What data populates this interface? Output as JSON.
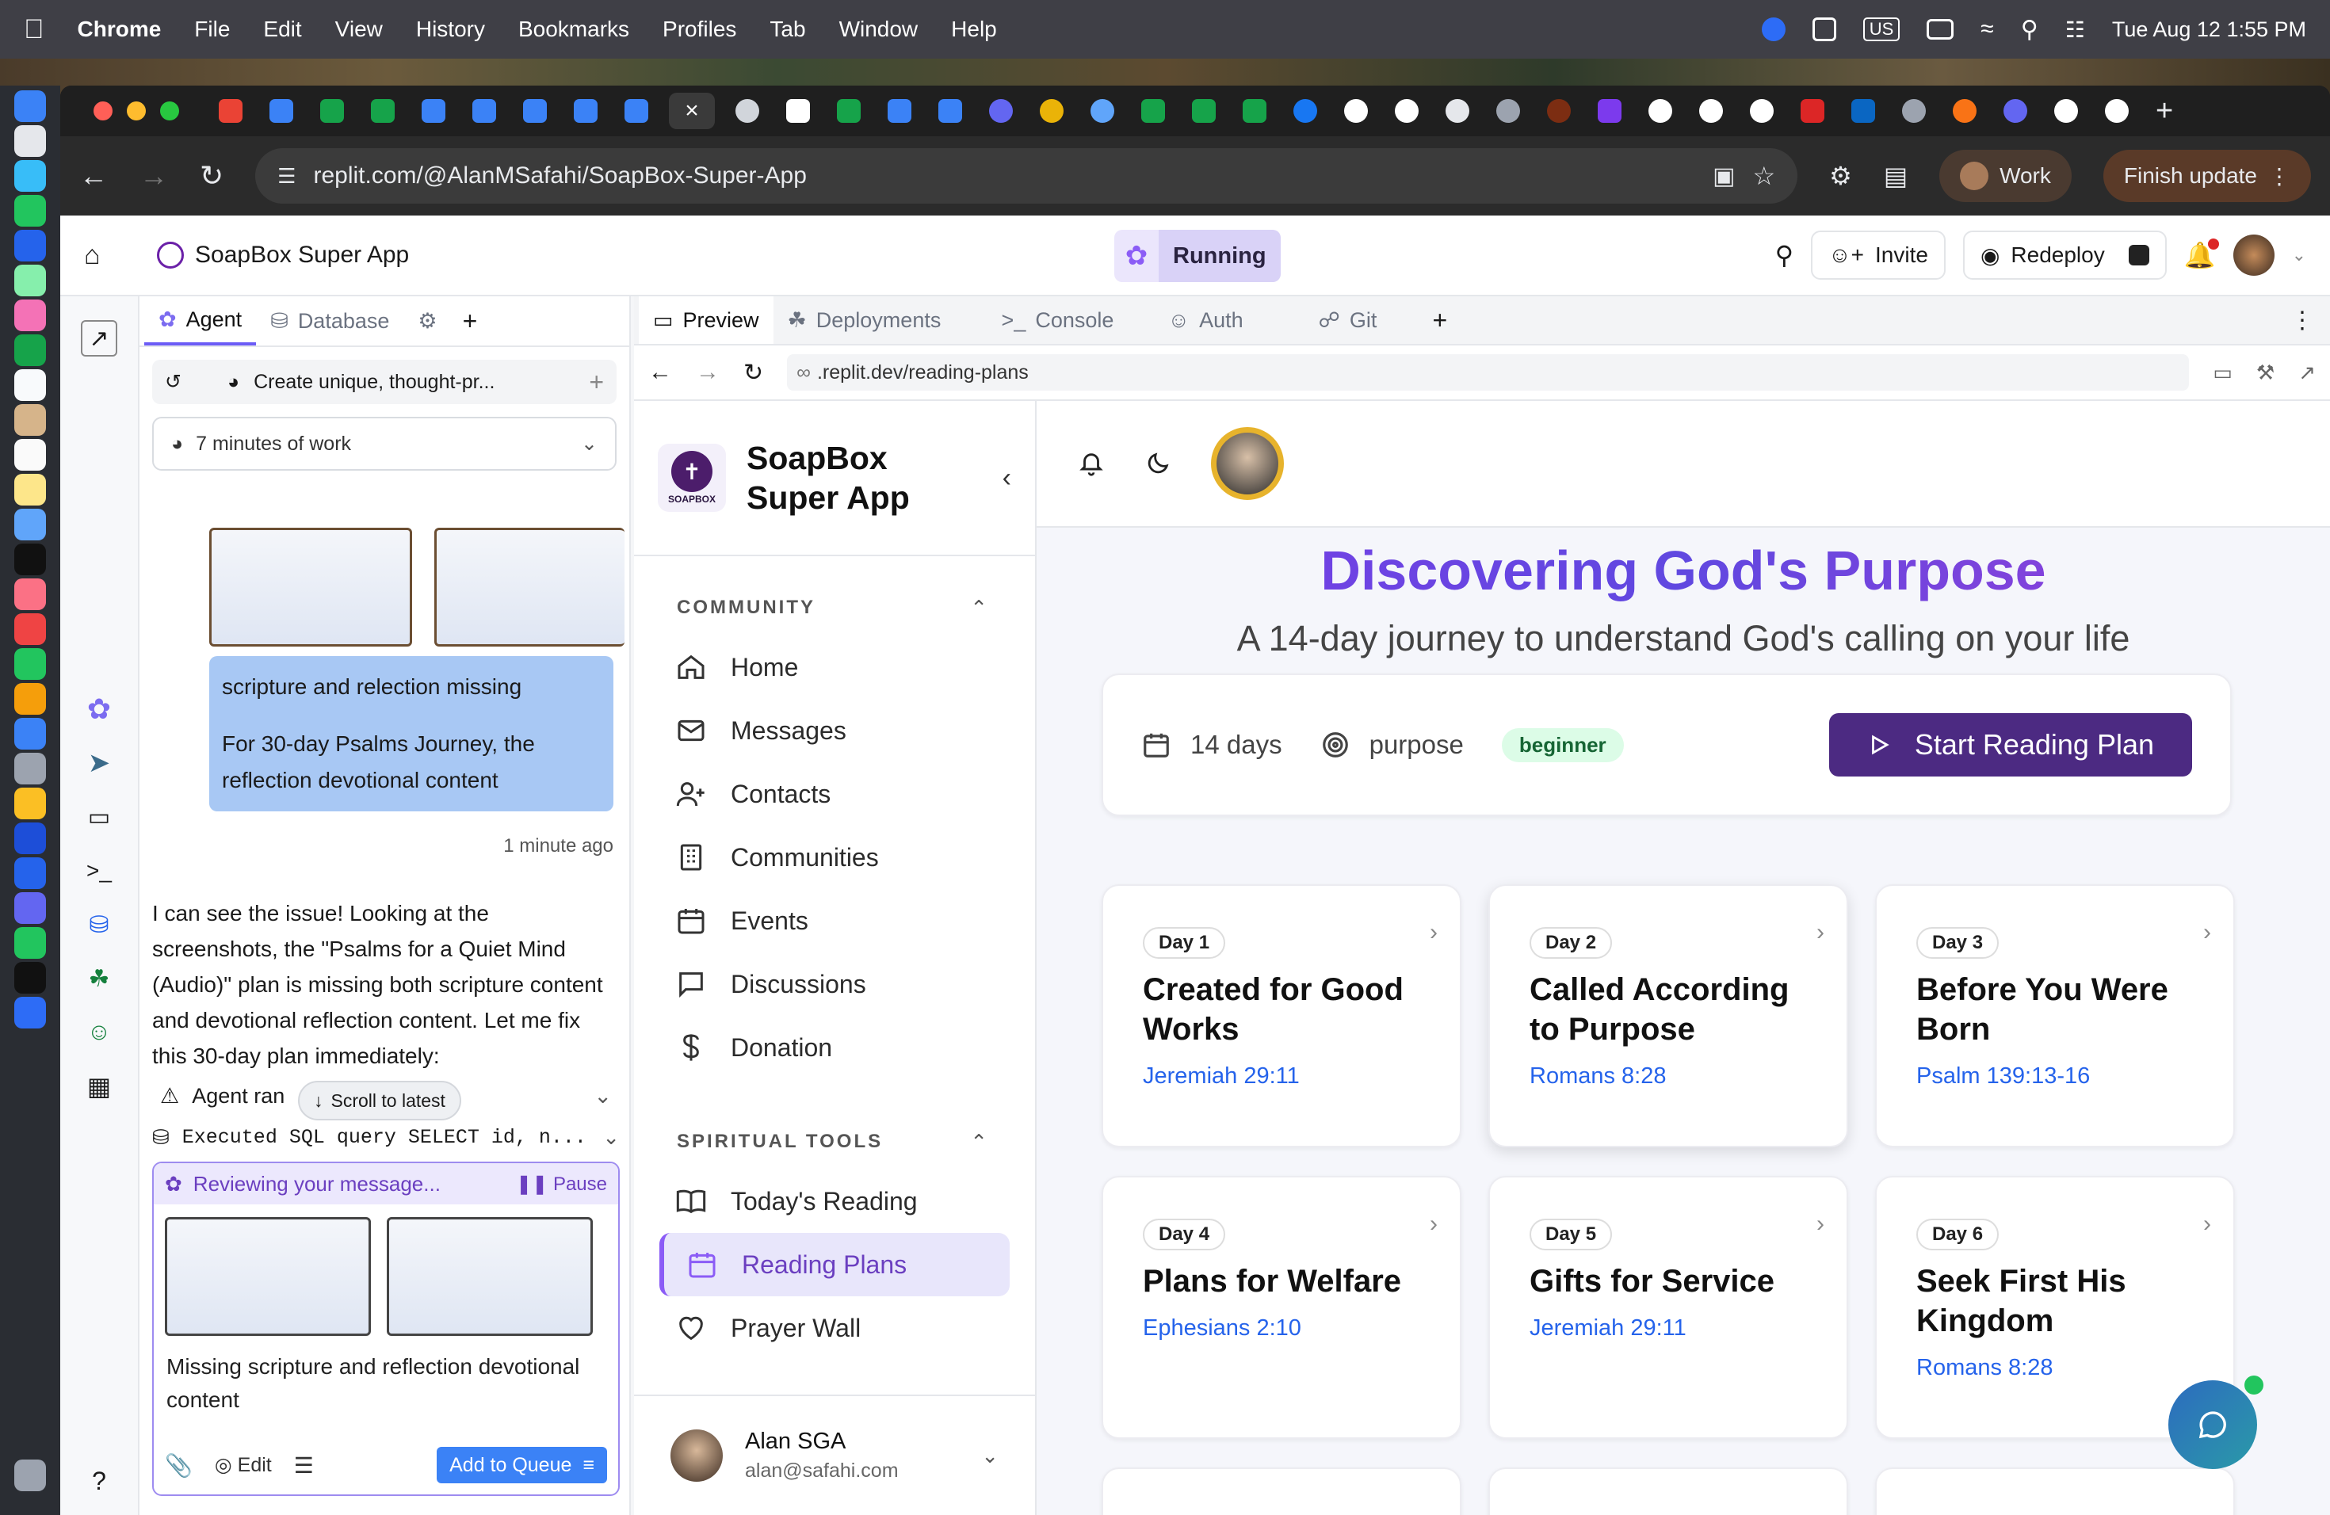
{
  "menubar": {
    "app": "Chrome",
    "items": [
      "File",
      "Edit",
      "View",
      "History",
      "Bookmarks",
      "Profiles",
      "Tab",
      "Window",
      "Help"
    ],
    "input_source": "US",
    "clock": "Tue Aug 12  1:55 PM"
  },
  "chrome": {
    "url": "replit.com/@AlanMSafahi/SoapBox-Super-App",
    "profile_label": "Work",
    "update_label": "Finish update"
  },
  "replit": {
    "project_name": "SoapBox Super App",
    "status": "Running",
    "invite_label": "Invite",
    "redeploy_label": "Redeploy",
    "left_tabs": [
      "Agent",
      "Database"
    ],
    "right_tabs": [
      "Preview",
      "Deployments",
      "Console",
      "Auth",
      "Git"
    ],
    "preview_url": ".replit.dev/reading-plans"
  },
  "agent": {
    "thread_title": "Create unique, thought-pr...",
    "work_time": "7 minutes of work",
    "user_msg_line1": "scripture and relection missing",
    "user_msg_line2": "For 30-day Psalms Journey, the reflection devotional content",
    "user_msg_time": "1 minute ago",
    "reply": "I can see the issue! Looking at the screenshots, the \"Psalms for a Quiet Mind (Audio)\" plan is missing both scripture content and devotional reflection content. Let me fix this 30-day plan immediately:",
    "agent_ran": "Agent ran",
    "scroll_latest": "Scroll to latest",
    "sql_step": "Executed SQL query SELECT id, n...",
    "reviewing": "Reviewing your message...",
    "pause_label": "Pause",
    "draft": "Missing scripture and reflection devotional content",
    "edit_label": "Edit",
    "queue_label": "Add to Queue"
  },
  "app": {
    "brand_line1": "SoapBox",
    "brand_line2": "Super App",
    "logo_text": "SOAPBOX",
    "community_header": "COMMUNITY",
    "community_items": [
      "Home",
      "Messages",
      "Contacts",
      "Communities",
      "Events",
      "Discussions",
      "Donation"
    ],
    "tools_header": "SPIRITUAL TOOLS",
    "tools_items": [
      "Today's Reading",
      "Reading Plans",
      "Prayer Wall"
    ],
    "user_name": "Alan SGA",
    "user_email": "alan@safahi.com",
    "plan_title": "Discovering God's Purpose",
    "plan_subtitle": "A 14-day journey to understand God's calling on your life",
    "plan_days": "14 days",
    "plan_topic": "purpose",
    "plan_level": "beginner",
    "start_label": "Start Reading Plan",
    "days": [
      {
        "chip": "Day 1",
        "title": "Created for Good Works",
        "ref": "Jeremiah 29:11"
      },
      {
        "chip": "Day 2",
        "title": "Called According to Purpose",
        "ref": "Romans 8:28"
      },
      {
        "chip": "Day 3",
        "title": "Before You Were Born",
        "ref": "Psalm 139:13-16"
      },
      {
        "chip": "Day 4",
        "title": "Plans for Welfare",
        "ref": "Ephesians 2:10"
      },
      {
        "chip": "Day 5",
        "title": "Gifts for Service",
        "ref": "Jeremiah 29:11"
      },
      {
        "chip": "Day 6",
        "title": "Seek First His Kingdom",
        "ref": "Romans 8:28"
      }
    ]
  },
  "colors": {
    "accent_purple": "#8b5cf6",
    "start_button": "#4c2a82",
    "link_blue": "#2563eb",
    "running_bg": "#d9d2f7",
    "agent_bubble": "#a8c8f4"
  }
}
